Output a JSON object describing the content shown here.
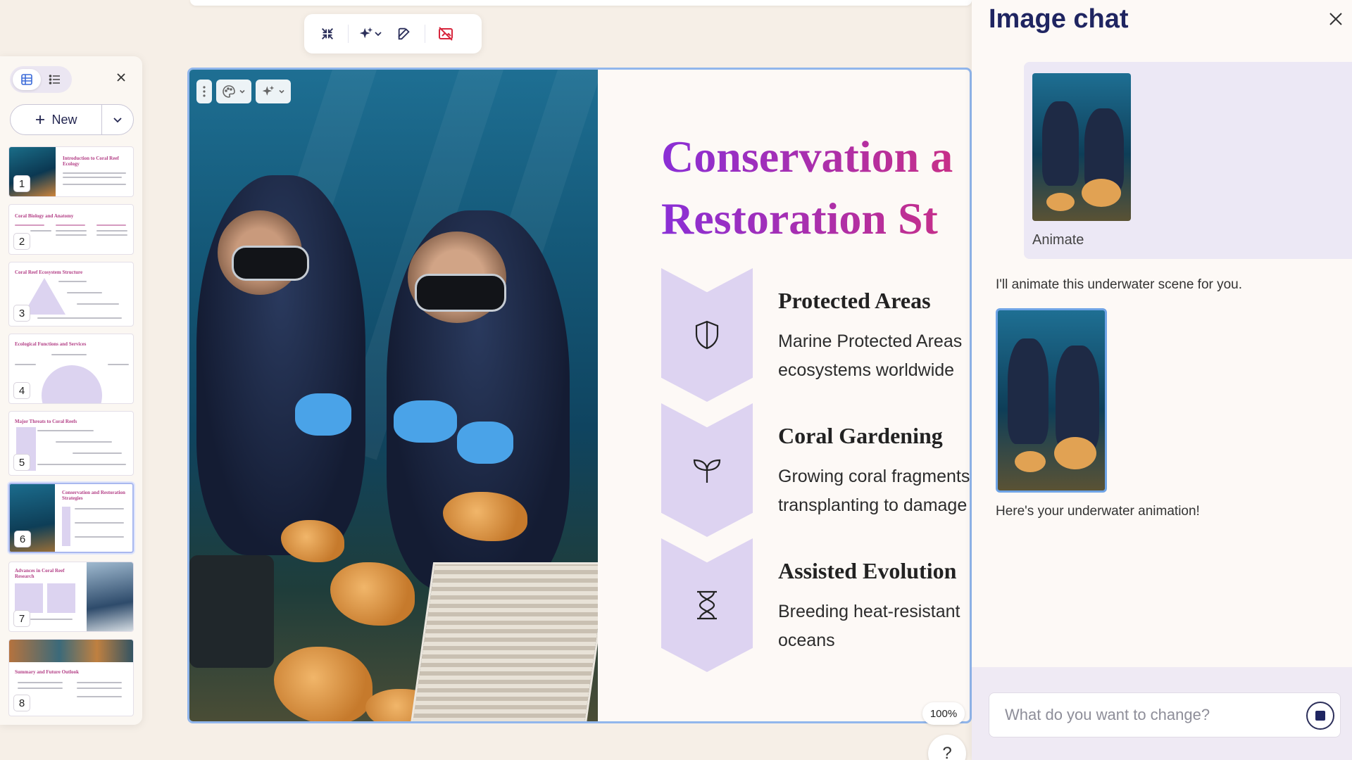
{
  "sidebar": {
    "new_label": "New",
    "slides": [
      {
        "num": "1",
        "title": "Introduction to Coral Reef Ecology"
      },
      {
        "num": "2",
        "title": "Coral Biology and Anatomy"
      },
      {
        "num": "3",
        "title": "Coral Reef Ecosystem Structure"
      },
      {
        "num": "4",
        "title": "Ecological Functions and Services"
      },
      {
        "num": "5",
        "title": "Major Threats to Coral Reefs"
      },
      {
        "num": "6",
        "title": "Conservation and Restoration Strategies"
      },
      {
        "num": "7",
        "title": "Advances in Coral Reef Research"
      },
      {
        "num": "8",
        "title": "Summary and Future Outlook"
      }
    ]
  },
  "slide": {
    "title_line1": "Conservation a",
    "title_line2": "Restoration St",
    "items": [
      {
        "title": "Protected Areas",
        "line1": "Marine Protected Areas",
        "line2": "ecosystems worldwide"
      },
      {
        "title": "Coral Gardening",
        "line1": "Growing coral fragments",
        "line2": "transplanting to damage"
      },
      {
        "title": "Assisted Evolution",
        "line1": "Breeding heat-resistant",
        "line2": "oceans"
      }
    ]
  },
  "zoom": "100%",
  "help": "?",
  "chat": {
    "title": "Image chat",
    "user_label": "Animate",
    "bot_message1": "I'll animate this underwater scene for you.",
    "bot_message2": "Here's your underwater animation!",
    "input_placeholder": "What do you want to change?"
  }
}
